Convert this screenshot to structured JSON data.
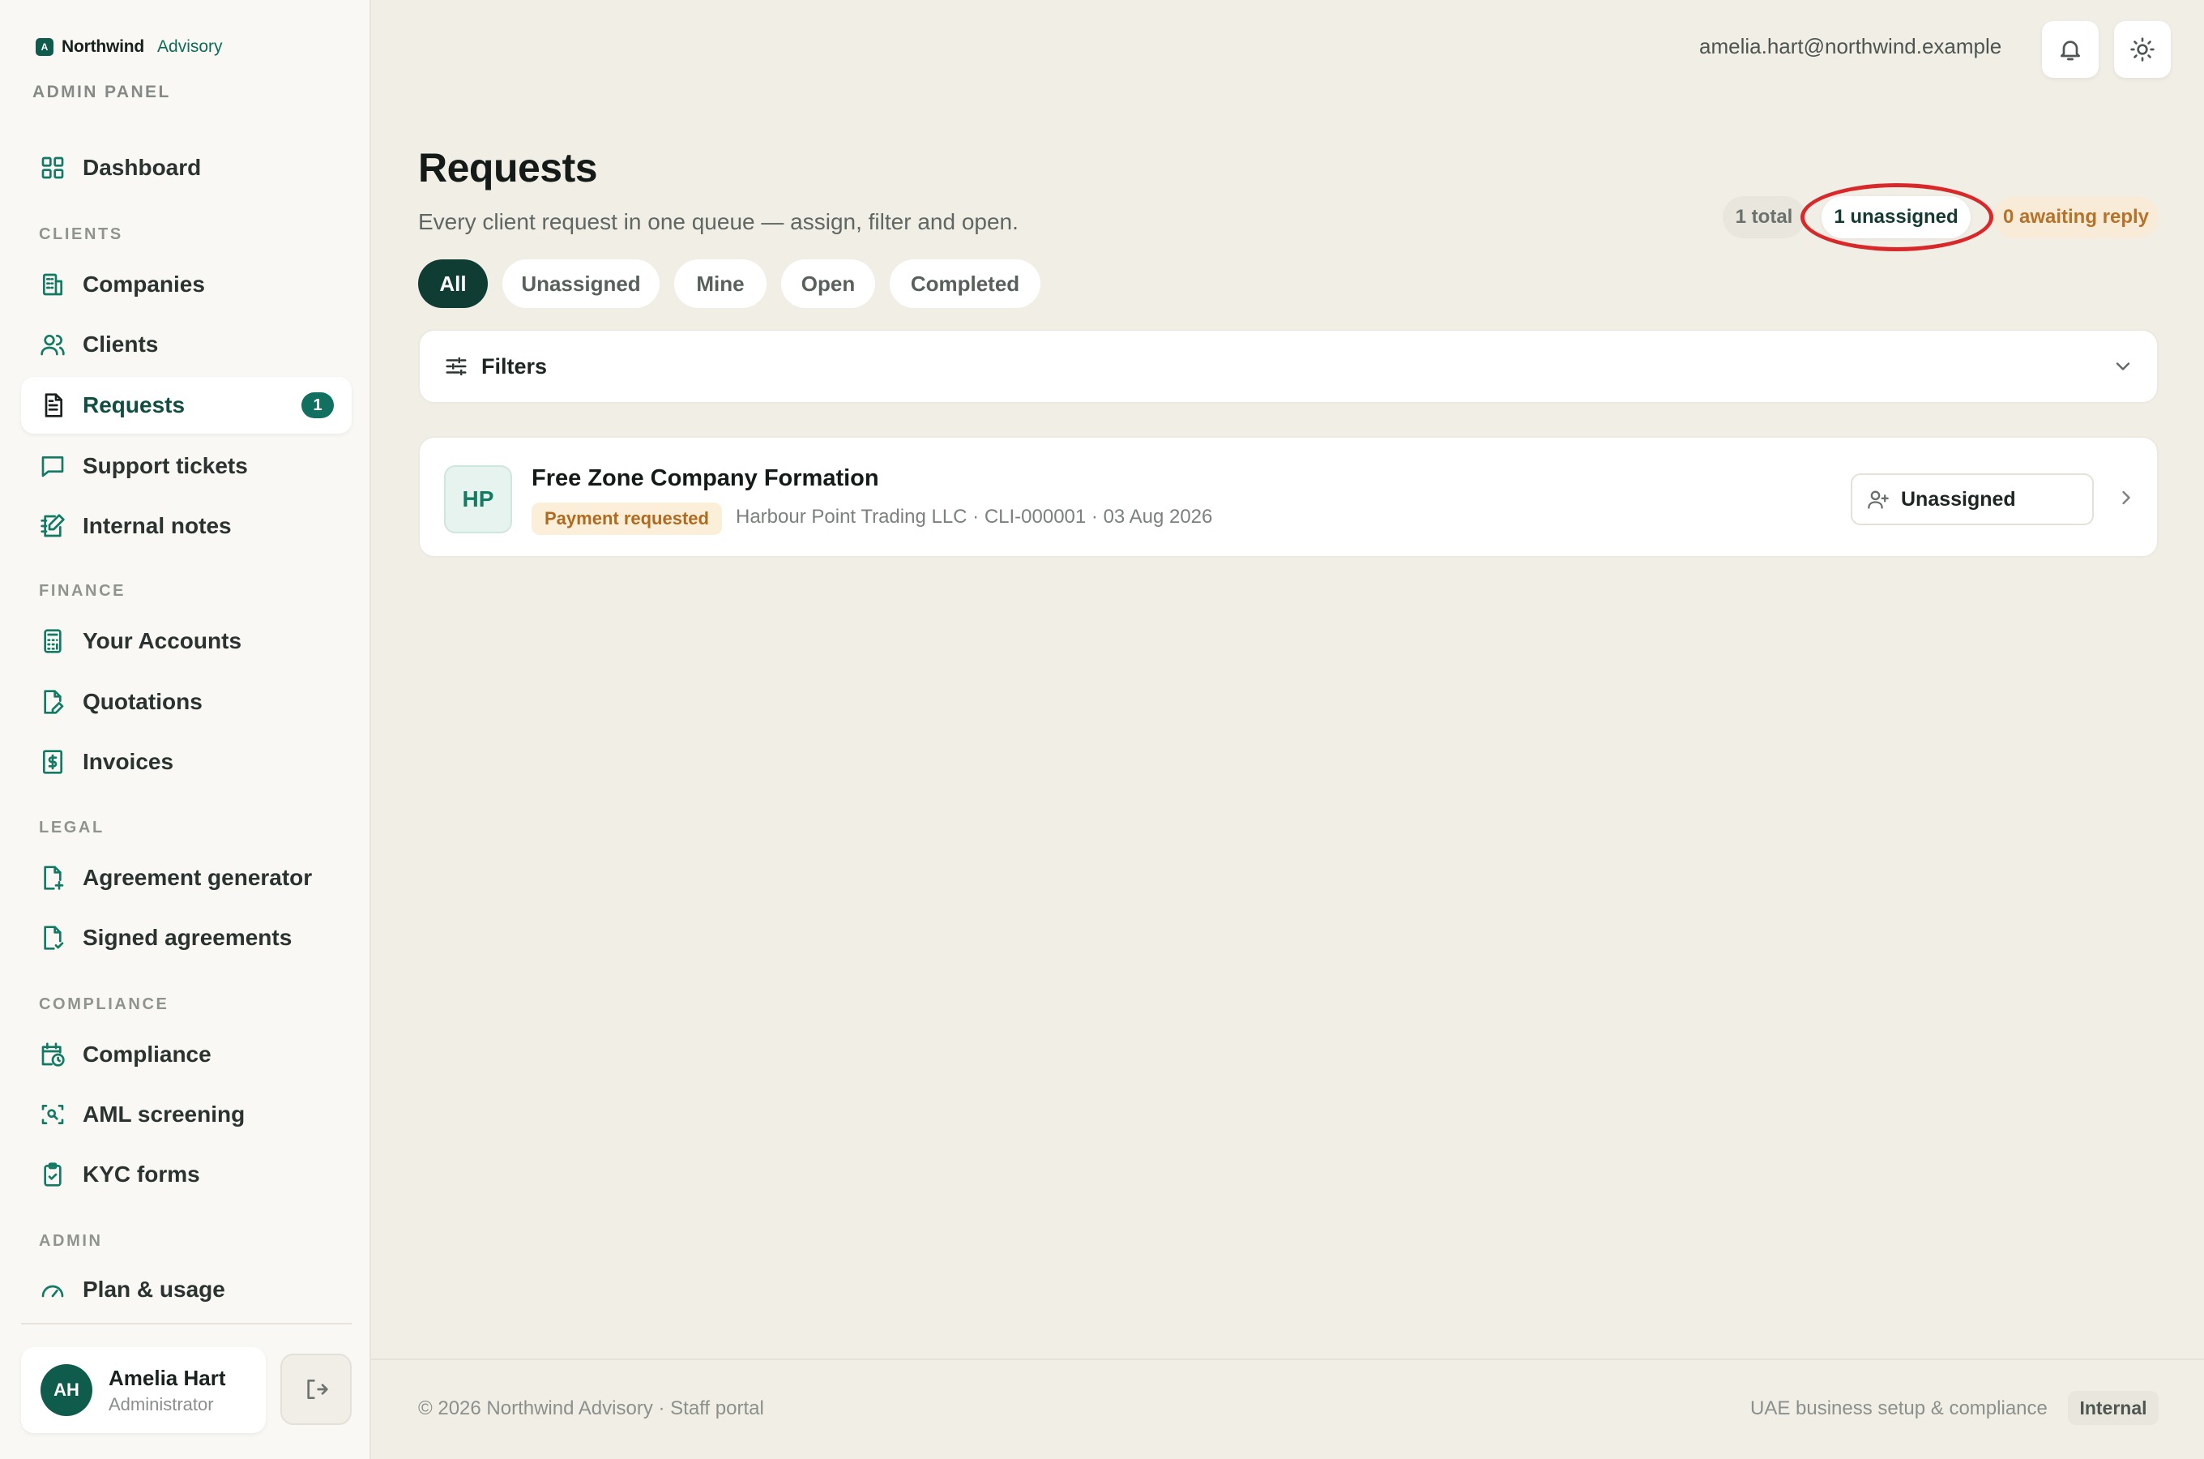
{
  "brand": {
    "name": "Northwind",
    "sub": "Advisory",
    "mark": "A"
  },
  "panel_label": "ADMIN PANEL",
  "sidebar": {
    "dashboard": "Dashboard",
    "sections": {
      "clients": "CLIENTS",
      "finance": "FINANCE",
      "legal": "LEGAL",
      "compliance": "COMPLIANCE",
      "admin": "ADMIN"
    },
    "items": {
      "companies": "Companies",
      "clients": "Clients",
      "requests": "Requests",
      "requests_badge": "1",
      "support_tickets": "Support tickets",
      "internal_notes": "Internal notes",
      "your_accounts": "Your Accounts",
      "quotations": "Quotations",
      "invoices": "Invoices",
      "agreement_generator": "Agreement generator",
      "signed_agreements": "Signed agreements",
      "compliance": "Compliance",
      "aml_screening": "AML screening",
      "kyc_forms": "KYC forms",
      "plan_usage": "Plan & usage"
    },
    "user": {
      "initials": "AH",
      "name": "Amelia Hart",
      "role": "Administrator"
    }
  },
  "topbar": {
    "email": "amelia.hart@northwind.example",
    "icons": [
      "bell-icon",
      "sun-icon"
    ]
  },
  "page": {
    "title": "Requests",
    "subtitle": "Every client request in one queue — assign, filter and open.",
    "stats": {
      "total": "1 total",
      "unassigned": "1 unassigned",
      "awaiting": "0 awaiting reply"
    },
    "tabs": [
      "All",
      "Unassigned",
      "Mine",
      "Open",
      "Completed"
    ],
    "active_tab": "All",
    "filters_label": "Filters"
  },
  "requests": [
    {
      "initials": "HP",
      "title": "Free Zone Company Formation",
      "status": "Payment requested",
      "meta": "Harbour Point Trading LLC · CLI-000001 · 03 Aug 2026",
      "assignee": "Unassigned"
    }
  ],
  "footer": {
    "left": "© 2026 Northwind Advisory · Staff portal",
    "right": "UAE business setup & compliance",
    "badge": "Internal"
  },
  "colors": {
    "accent": "#0f5c4c",
    "highlight_ring": "#d8282a",
    "status_warning": "#b06a1f"
  }
}
